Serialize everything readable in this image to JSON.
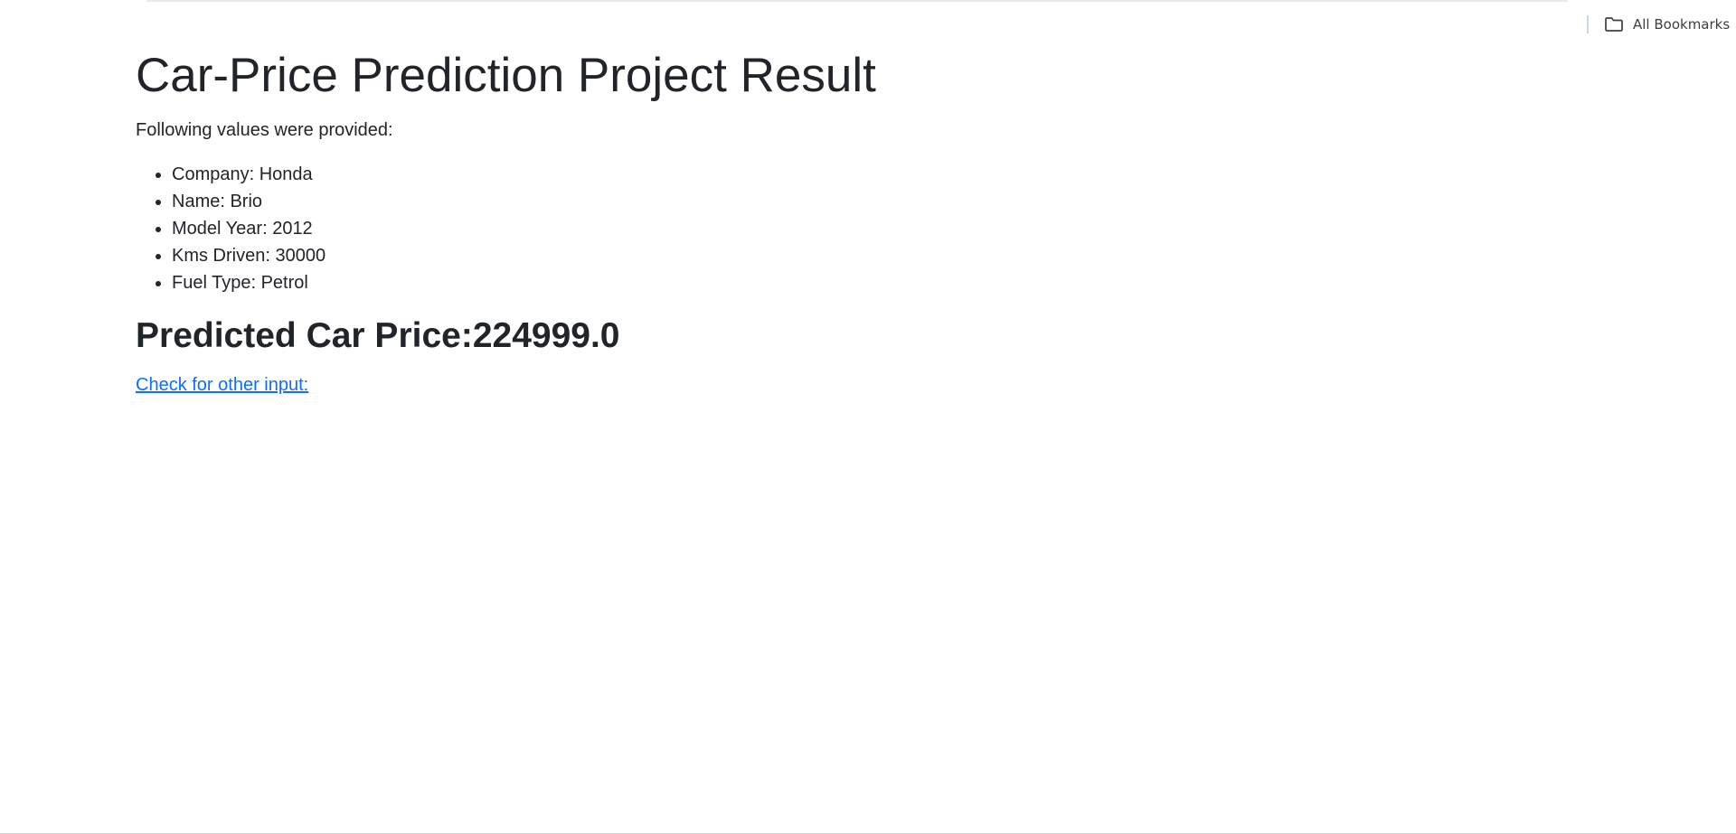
{
  "browser": {
    "bookmarks": {
      "all_bookmarks_label": "All Bookmarks",
      "icon": "folder-icon"
    }
  },
  "page": {
    "title": "Car-Price Prediction Project Result",
    "intro": "Following values were provided:",
    "values": [
      {
        "text": "Company: Honda"
      },
      {
        "text": "Name: Brio"
      },
      {
        "text": "Model Year: 2012"
      },
      {
        "text": "Kms Driven: 30000"
      },
      {
        "text": "Fuel Type: Petrol"
      }
    ],
    "result_heading": "Predicted Car Price:224999.0",
    "other_input_link": "Check for other input:"
  },
  "colors": {
    "text": "#212529",
    "link": "#0d6efd",
    "background": "#ffffff"
  }
}
